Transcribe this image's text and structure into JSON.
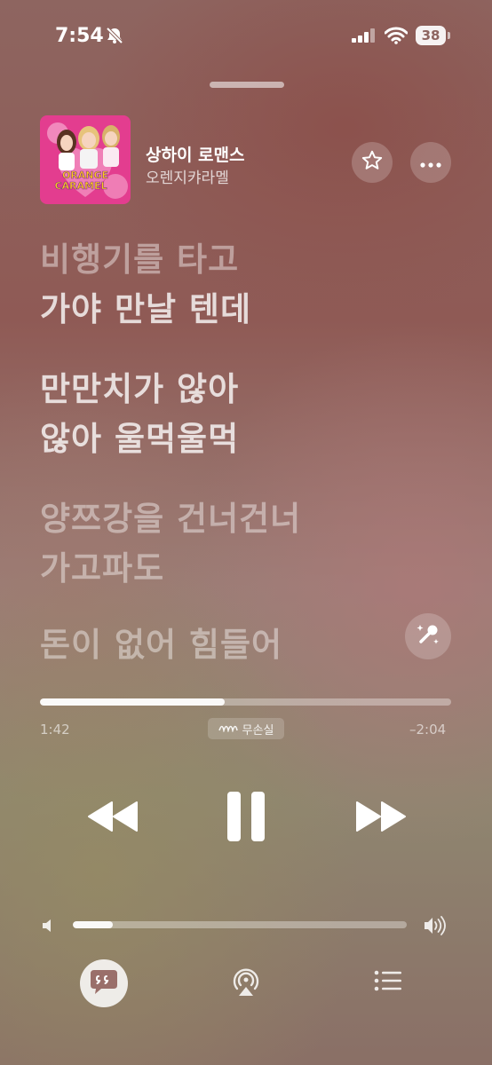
{
  "status_bar": {
    "time": "7:54",
    "battery": "38",
    "icons": [
      "bell-slash-icon",
      "cellular-signal-icon",
      "wifi-icon",
      "battery-icon"
    ]
  },
  "now_playing": {
    "title": "상하이 로맨스",
    "artist": "오렌지캬라멜",
    "album_art_text": [
      "ORANGE",
      "CARAMEL"
    ],
    "favorite_icon": "star-icon",
    "more_icon": "ellipsis-icon"
  },
  "lyrics": [
    {
      "text": "비행기를 타고",
      "state": "past"
    },
    {
      "text": "가야 만날 텐데",
      "state": "current"
    },
    {
      "text": "만만치가 않아",
      "state": "current"
    },
    {
      "text": "않아 울먹울먹",
      "state": "current"
    },
    {
      "text": "양쯔강을 건너건너",
      "state": "upcoming"
    },
    {
      "text": "가고파도",
      "state": "upcoming"
    },
    {
      "text": "돈이 없어 힘들어",
      "state": "upcoming"
    }
  ],
  "sing_icon": "microphone-sparkle-icon",
  "progress": {
    "elapsed": "1:42",
    "remaining": "–2:04",
    "fraction": 0.45,
    "badge_label": "무손실",
    "badge_icon": "lossless-waveform-icon"
  },
  "transport": {
    "rewind_icon": "backward-icon",
    "pause_icon": "pause-icon",
    "forward_icon": "forward-icon"
  },
  "volume": {
    "level": 0.12,
    "low_icon": "speaker-low-icon",
    "high_icon": "speaker-high-icon"
  },
  "bottom_bar": {
    "lyrics_icon": "lyrics-quote-bubble-icon",
    "airplay_icon": "airplay-icon",
    "queue_icon": "list-icon"
  },
  "colors": {
    "background_top": "#8e6560",
    "background_bottom": "#8f8670",
    "text_primary": "#ffffff"
  }
}
